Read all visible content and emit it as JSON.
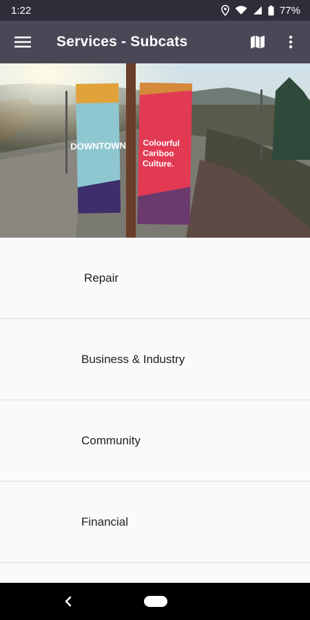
{
  "status_bar": {
    "time": "1:22",
    "battery": "77%",
    "icons": [
      "location-icon",
      "wifi-icon",
      "signal-icon",
      "battery-icon"
    ]
  },
  "app_bar": {
    "title": "Services - Subcats",
    "icons": [
      "hamburger-menu-icon",
      "map-icon",
      "more-vert-icon"
    ]
  },
  "hero": {
    "banner_left_text": "DOWNTOWN",
    "banner_right_text": "Colourful Cariboo Culture."
  },
  "list": {
    "items": [
      {
        "label": "Repair"
      },
      {
        "label": "Business & Industry"
      },
      {
        "label": "Community"
      },
      {
        "label": "Financial"
      },
      {
        "label": ""
      }
    ]
  },
  "nav_bar": {
    "icons": [
      "back-icon",
      "home-pill-icon"
    ]
  },
  "colors": {
    "status_bar": "#2f2d3a",
    "app_bar": "#4a4756",
    "background": "#fafafa",
    "divider": "#dcdcdc"
  }
}
